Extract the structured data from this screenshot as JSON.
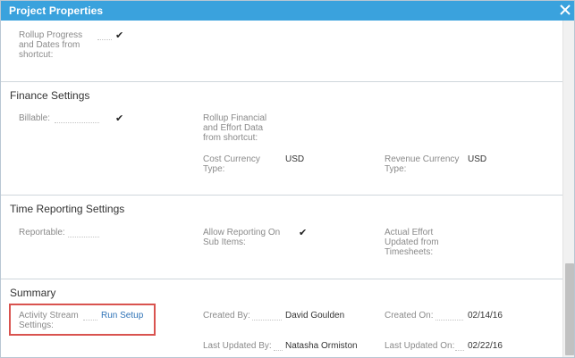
{
  "window": {
    "title": "Project Properties"
  },
  "icons": {
    "close": "close-icon",
    "check": "checkmark-icon"
  },
  "colors": {
    "titlebar": "#3aa2dd",
    "link": "#2f73b7",
    "highlight": "#d9534f"
  },
  "rollup": {
    "progress_label": "Rollup Progress and Dates from shortcut:",
    "progress_line1": "Rollup Progress",
    "progress_line2": "and Dates from",
    "progress_line3": "shortcut:",
    "check": "✔"
  },
  "finance": {
    "title": "Finance Settings",
    "billable_label": "Billable:",
    "billable_check": "✔",
    "rollup_fin_line1": "Rollup Financial",
    "rollup_fin_line2": "and Effort Data",
    "rollup_fin_line3": "from shortcut:",
    "cost_currency_line1": "Cost Currency",
    "cost_currency_line2": "Type:",
    "cost_currency_value": "USD",
    "revenue_currency_line1": "Revenue Currency",
    "revenue_currency_line2": "Type:",
    "revenue_currency_value": "USD"
  },
  "time_reporting": {
    "title": "Time Reporting Settings",
    "reportable_label": "Reportable:",
    "allow_line1": "Allow Reporting On",
    "allow_line2": "Sub Items:",
    "allow_check": "✔",
    "actual_line1": "Actual Effort",
    "actual_line2": "Updated from",
    "actual_line3": "Timesheets:"
  },
  "summary": {
    "title": "Summary",
    "activity_line1": "Activity Stream",
    "activity_line2": "Settings:",
    "run_setup": "Run Setup",
    "created_by_label": "Created By:",
    "created_by_value": "David Goulden",
    "created_on_label": "Created On:",
    "created_on_value": "02/14/16",
    "last_updated_by_label": "Last Updated By:",
    "last_updated_by_value": "Natasha Ormiston",
    "last_updated_on_label": "Last Updated On:",
    "last_updated_on_value": "02/22/16"
  }
}
